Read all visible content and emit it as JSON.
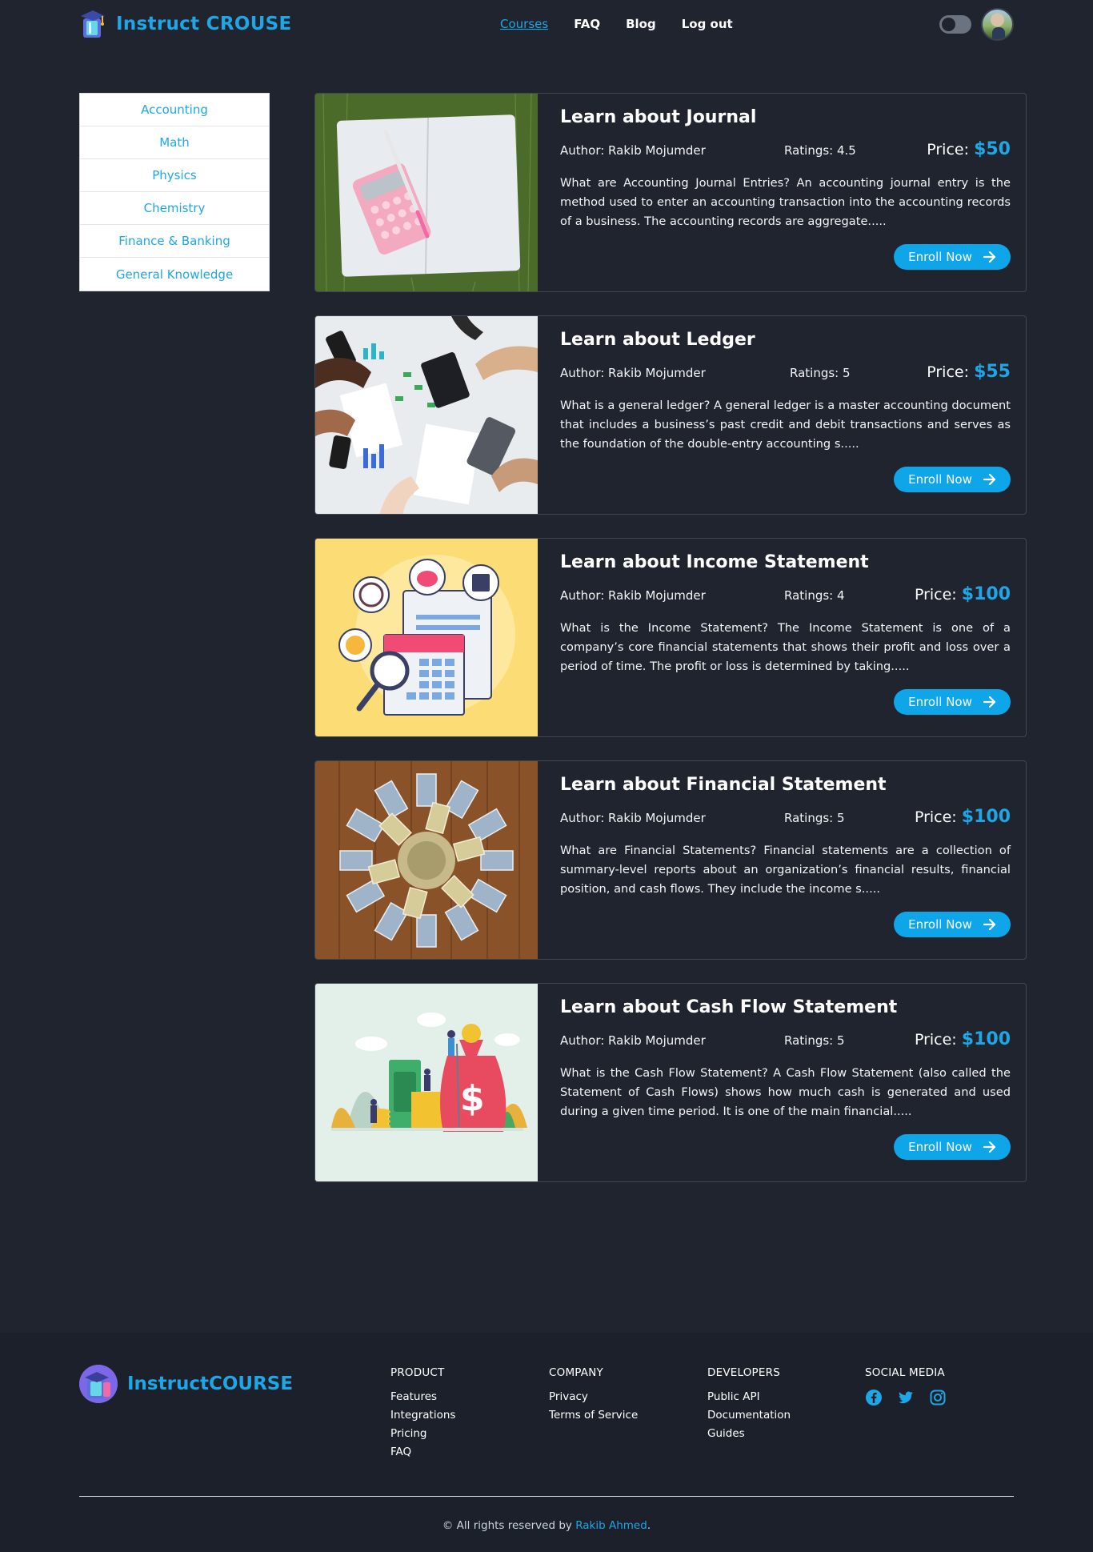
{
  "header": {
    "brand": "Instruct CROUSE",
    "nav": [
      "Courses",
      "FAQ",
      "Blog",
      "Log out"
    ]
  },
  "sidebar": {
    "categories": [
      "Accounting",
      "Math",
      "Physics",
      "Chemistry",
      "Finance & Banking",
      "General Knowledge"
    ]
  },
  "courses": [
    {
      "title": "Learn about Journal",
      "author": "Author: Rakib Mojumder",
      "ratings": "Ratings: 4.5",
      "price_label": "Price:",
      "price": "$50",
      "description": "What are Accounting Journal Entries? An accounting journal entry is the method used to enter an accounting transaction into the accounting records of a business. The accounting records are aggregate.....",
      "button": "Enroll Now"
    },
    {
      "title": "Learn about Ledger",
      "author": "Author: Rakib Mojumder",
      "ratings": "Ratings: 5",
      "price_label": "Price:",
      "price": "$55",
      "description": "What is a general ledger? A general ledger is a master accounting document that includes a business’s past credit and debit transactions and serves as the foundation of the double-entry accounting s.....",
      "button": "Enroll Now"
    },
    {
      "title": "Learn about Income Statement",
      "author": "Author: Rakib Mojumder",
      "ratings": "Ratings: 4",
      "price_label": "Price:",
      "price": "$100",
      "description": "What is the Income Statement? The Income Statement is one of a company’s core financial statements that shows their profit and loss over a period of time. The profit or loss is determined by taking.....",
      "button": "Enroll Now"
    },
    {
      "title": "Learn about Financial Statement",
      "author": "Author: Rakib Mojumder",
      "ratings": "Ratings: 5",
      "price_label": "Price:",
      "price": "$100",
      "description": "What are Financial Statements? Financial statements are a collection of summary-level reports about an organization’s financial results, financial position, and cash flows. They include the income s.....",
      "button": "Enroll Now"
    },
    {
      "title": "Learn about Cash Flow Statement",
      "author": "Author: Rakib Mojumder",
      "ratings": "Ratings: 5",
      "price_label": "Price:",
      "price": "$100",
      "description": "What is the Cash Flow Statement? A Cash Flow Statement (also called the Statement of Cash Flows) shows how much cash is generated and used during a given time period. It is one of the main financial.....",
      "button": "Enroll Now"
    }
  ],
  "footer": {
    "brand": "InstructCOURSE",
    "columns": [
      {
        "heading": "PRODUCT",
        "links": [
          "Features",
          "Integrations",
          "Pricing",
          "FAQ"
        ]
      },
      {
        "heading": "COMPANY",
        "links": [
          "Privacy",
          "Terms of Service"
        ]
      },
      {
        "heading": "DEVELOPERS",
        "links": [
          "Public API",
          "Documentation",
          "Guides"
        ]
      }
    ],
    "social_heading": "SOCIAL MEDIA",
    "social_icons": [
      "facebook-icon",
      "twitter-icon",
      "instagram-icon"
    ],
    "copyright_prefix": "© All rights reserved by",
    "copyright_name": "Rakib Ahmed",
    "copyright_suffix": "."
  },
  "colors": {
    "background": "#20242f",
    "accent": "#1ea6e6",
    "button": "#0ea5e9",
    "footer_bg": "#1b202a"
  }
}
